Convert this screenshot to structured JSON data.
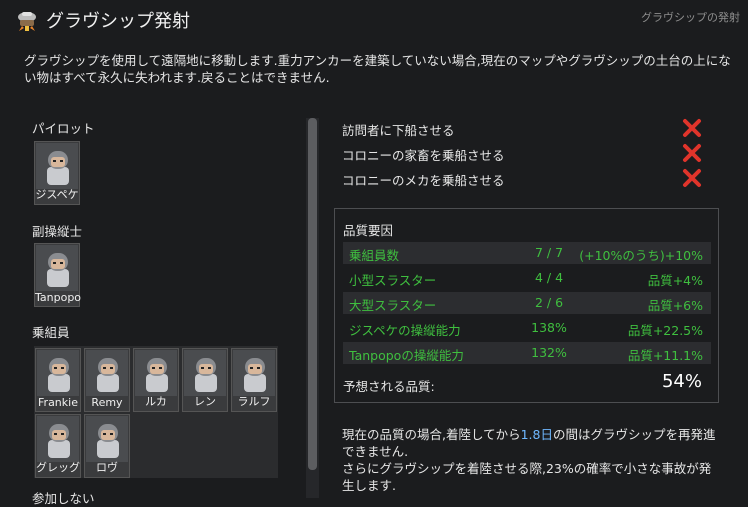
{
  "window": {
    "title": "グラヴシップ発射",
    "corner_title": "グラヴシップの発射",
    "icon": "gravship-icon"
  },
  "description": "グラヴシップを使用して遠隔地に移動します.重力アンカーを建築していない場合,現在のマップやグラヴシップの土台の上にない物はすべて永久に失われます.戻ることはできません.",
  "roles": {
    "pilot": {
      "label": "パイロット",
      "members": [
        "ジスペケ"
      ]
    },
    "copilot": {
      "label": "副操縦士",
      "members": [
        "Tanpopo"
      ]
    },
    "crew": {
      "label": "乗組員",
      "members": [
        "Frankie",
        "Remy",
        "ルカ",
        "レン",
        "ラルフ",
        "グレッグ",
        "ロヴ"
      ]
    },
    "not_joining": {
      "label": "参加しない"
    }
  },
  "checks": [
    {
      "label": "訪問者に下船させる",
      "state": "off"
    },
    {
      "label": "コロニーの家畜を乗船させる",
      "state": "off"
    },
    {
      "label": "コロニーのメカを乗船させる",
      "state": "off"
    }
  ],
  "quality": {
    "title": "品質要因",
    "rows": [
      {
        "label": "乗組員数",
        "value": "7 / 7",
        "effect": "(+10%のうち)+10%"
      },
      {
        "label": "小型スラスター",
        "value": "4 / 4",
        "effect": "品質+4%"
      },
      {
        "label": "大型スラスター",
        "value": "2 / 6",
        "effect": "品質+6%"
      },
      {
        "label": "ジスペケの操縦能力",
        "value": "138%",
        "effect": "品質+22.5%"
      },
      {
        "label": "Tanpopoの操縦能力",
        "value": "132%",
        "effect": "品質+11.1%"
      }
    ],
    "expected_label": "予想される品質:",
    "expected_value": "54%"
  },
  "notes": {
    "line1_pre": "現在の品質の場合,着陸してから",
    "line1_days": "1.8日",
    "line1_post": "の間はグラヴシップを再発進できません.",
    "line2": "さらにグラヴシップを着陸させる際,23%の確率で小さな事故が発生します."
  },
  "colors": {
    "accent_green": "#3fbf3f",
    "danger_red": "#e0342b",
    "highlight_blue": "#6fb8ff",
    "background": "#1b1c1e"
  }
}
